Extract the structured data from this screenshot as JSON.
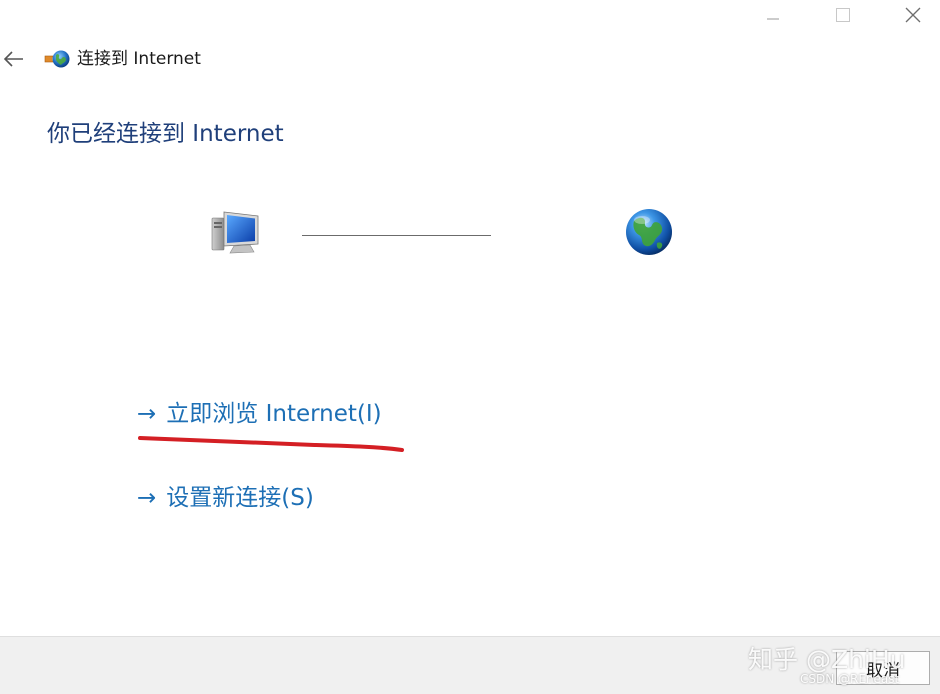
{
  "window": {
    "title": "连接到 Internet",
    "caption_icons": [
      "minimize-icon",
      "maximize-icon",
      "close-icon"
    ]
  },
  "nav": {
    "back_icon": "back-arrow-icon"
  },
  "main": {
    "heading": "你已经连接到 Internet",
    "diagram": {
      "left_icon": "computer-icon",
      "right_icon": "globe-icon"
    },
    "links": {
      "browse_arrow": "→",
      "browse_label": "立即浏览 Internet(I)",
      "new_arrow": "→",
      "new_label": "设置新连接(S)"
    }
  },
  "footer": {
    "cancel_label": "取消"
  },
  "watermarks": {
    "zhihu": "知乎 @ZhiHu",
    "csdn": "CSDN @REneast"
  },
  "colors": {
    "heading": "#1f3f7a",
    "link": "#1d6fb5",
    "annotation": "#d41f24"
  }
}
